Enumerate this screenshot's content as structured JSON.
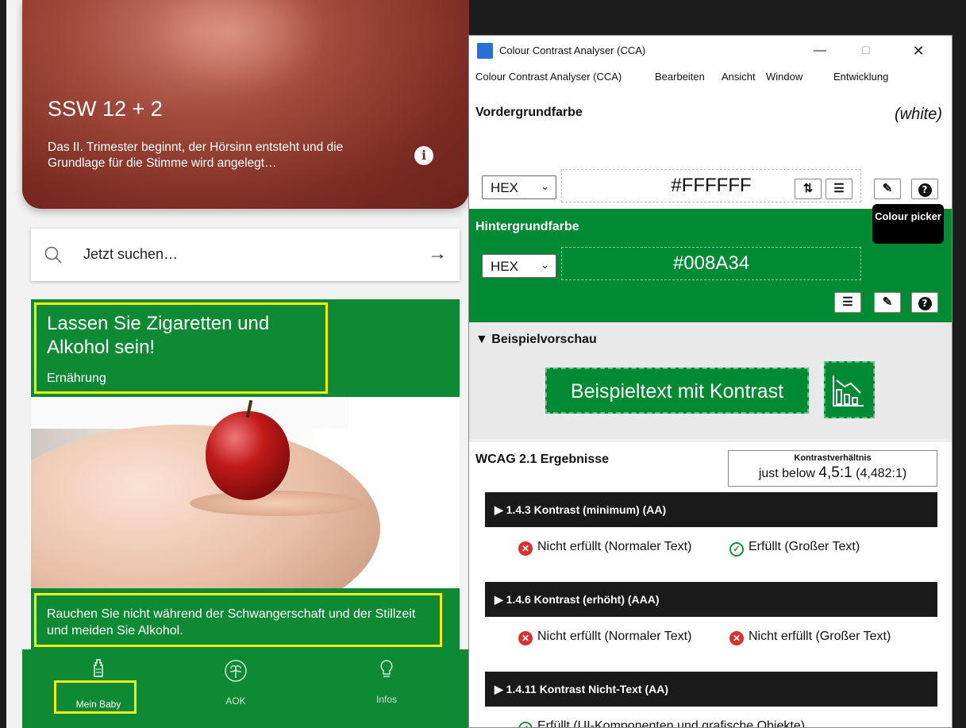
{
  "app": {
    "hero": {
      "week": "SSW 12 + 2",
      "text": "Das II. Trimester beginnt, der Hörsinn entsteht und die Grundlage für die Stimme wird angelegt…"
    },
    "search": {
      "placeholder": "Jetzt suchen…"
    },
    "article": {
      "title": "Lassen Sie Zigaretten und Alkohol sein!",
      "category": "Ernährung",
      "teaser": "Rauchen Sie nicht während der Schwangerschaft und der Stillzeit und meiden Sie Alkohol."
    },
    "nav": [
      {
        "label": "Mein Baby",
        "icon": "baby-bottle-icon",
        "active": true
      },
      {
        "label": "AOK",
        "icon": "aok-tree-icon",
        "active": false
      },
      {
        "label": "Infos",
        "icon": "lightbulb-icon",
        "active": false
      }
    ],
    "colors": {
      "green": "#0d8a33",
      "highlight": "#f5ec12"
    }
  },
  "cca": {
    "window_title": "Colour Contrast Analyser (CCA)",
    "menu": [
      "Colour Contrast Analyser (CCA)",
      "Bearbeiten",
      "Ansicht",
      "Window",
      "Entwicklung"
    ],
    "foreground": {
      "title": "Vordergrundfarbe",
      "color_name": "(white)",
      "format": "HEX",
      "value": "#FFFFFF"
    },
    "background": {
      "title": "Hintergrundfarbe",
      "format": "HEX",
      "value": "#008A34"
    },
    "tooltip": "Colour picker",
    "preview": {
      "title": "▼ Beispielvorschau",
      "sample_text": "Beispieltext mit Kontrast"
    },
    "results": {
      "title": "WCAG 2.1 Ergebnisse",
      "ratio_label": "Kontrastverhältnis",
      "ratio_prefix": "just below",
      "ratio_main": "4,5:1",
      "ratio_exact": "(4,482:1)",
      "criteria": [
        {
          "title": "▶ 1.4.3 Kontrast (minimum) (AA)",
          "normal": "Nicht erfüllt (Normaler Text)",
          "large": "Erfüllt (Großer Text)"
        },
        {
          "title": "▶ 1.4.6 Kontrast (erhöht) (AAA)",
          "normal": "Nicht erfüllt (Normaler Text)",
          "large": "Nicht erfüllt (Großer Text)"
        },
        {
          "title": "▶ 1.4.11 Kontrast Nicht-Text (AA)",
          "result": "Erfüllt (UI-Komponenten und grafische Objekte)"
        }
      ]
    }
  }
}
